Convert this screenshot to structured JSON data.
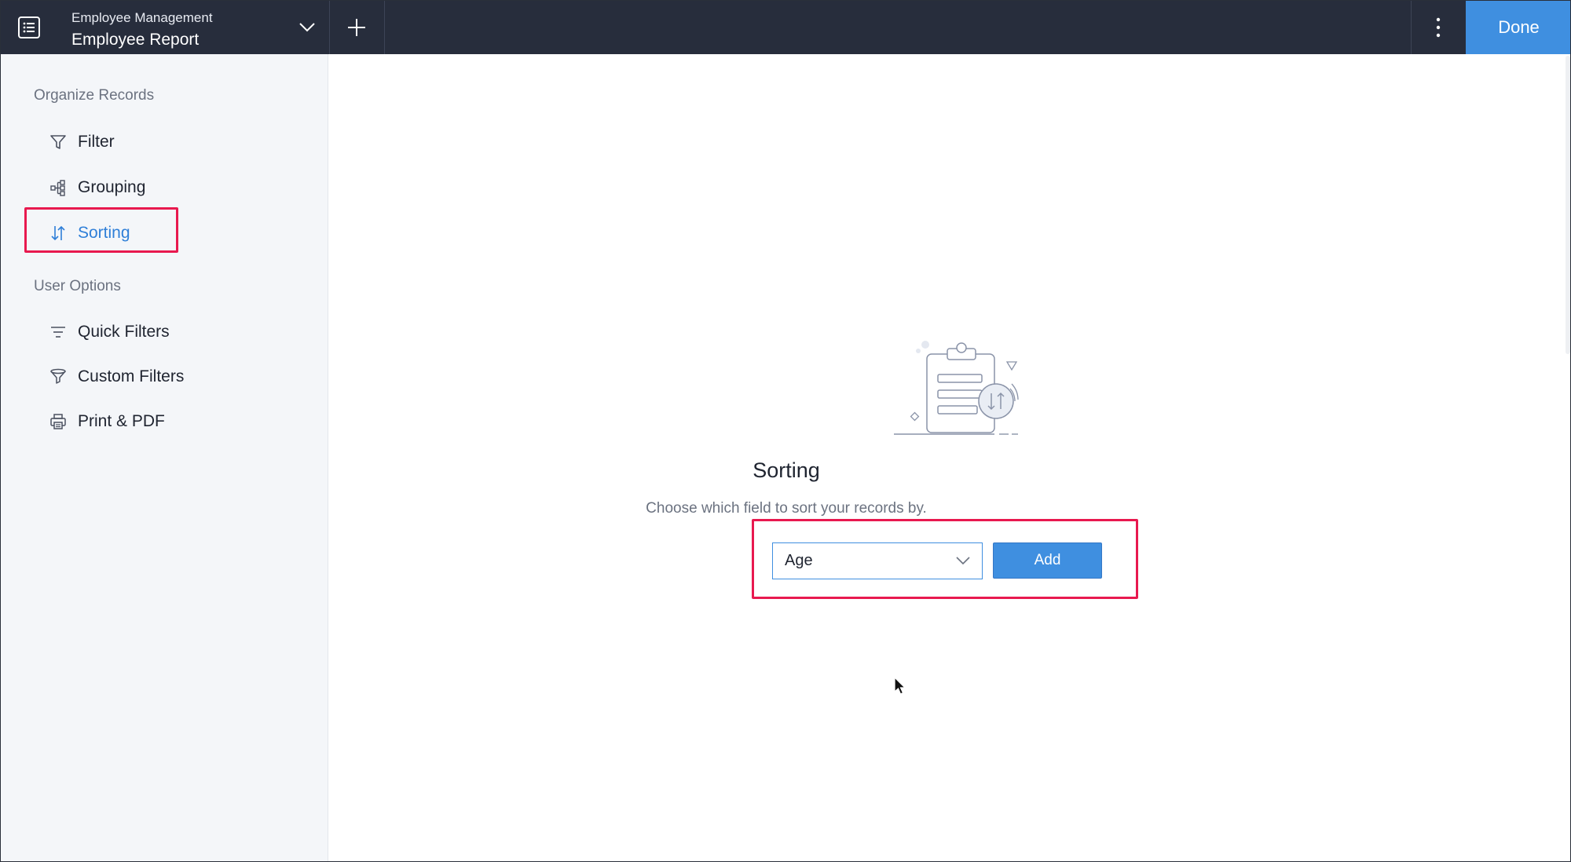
{
  "header": {
    "app_name": "Employee Management",
    "report_name": "Employee Report",
    "done_label": "Done"
  },
  "sidebar": {
    "section_organize": "Organize Records",
    "section_user_options": "User Options",
    "items": [
      {
        "label": "Filter",
        "icon": "filter-icon"
      },
      {
        "label": "Grouping",
        "icon": "grouping-icon"
      },
      {
        "label": "Sorting",
        "icon": "sort-icon",
        "active": true
      },
      {
        "label": "Quick Filters",
        "icon": "quick-filters-icon"
      },
      {
        "label": "Custom Filters",
        "icon": "custom-filter-icon"
      },
      {
        "label": "Print & PDF",
        "icon": "printer-icon"
      }
    ]
  },
  "main": {
    "title": "Sorting",
    "description": "Choose which field to sort your records by.",
    "field_select": {
      "value": "Age"
    },
    "add_label": "Add"
  },
  "colors": {
    "header_bg": "#272d3c",
    "accent": "#3f8fe0",
    "highlight": "#e8194f",
    "sidebar_bg": "#f4f6f9"
  }
}
